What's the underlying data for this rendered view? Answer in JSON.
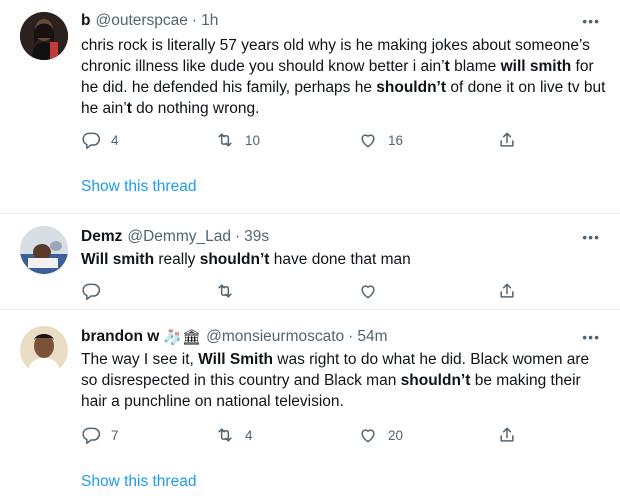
{
  "tweets": [
    {
      "name": "b",
      "handle": "@outerspcae",
      "time": "1h",
      "more": "•••",
      "text_parts": [
        {
          "t": "chris rock is literally 57 years old why is he making jokes about someone’s chronic illness like dude you should know better i ain’"
        },
        {
          "t": "t",
          "b": true
        },
        {
          "t": " blame "
        },
        {
          "t": "will smith",
          "b": true
        },
        {
          "t": " for he did. he defended his family, perhaps he "
        },
        {
          "t": "shouldn’t",
          "b": true
        },
        {
          "t": " of done it on live tv but he ain’"
        },
        {
          "t": "t",
          "b": true
        },
        {
          "t": " do nothing wrong."
        }
      ],
      "replies": "4",
      "retweets": "10",
      "likes": "16",
      "show_thread": "Show this thread"
    },
    {
      "name": "Demz",
      "handle": "@Demmy_Lad",
      "time": "39s",
      "more": "•••",
      "text_parts": [
        {
          "t": "Will smith",
          "b": true
        },
        {
          "t": " really "
        },
        {
          "t": "shouldn’t",
          "b": true
        },
        {
          "t": " have done that man"
        }
      ],
      "replies": "",
      "retweets": "",
      "likes": ""
    },
    {
      "name": "brandon w",
      "name_emojis": "🧦🏛",
      "handle": "@monsieurmoscato",
      "time": "54m",
      "more": "•••",
      "text_parts": [
        {
          "t": "The way I see it, "
        },
        {
          "t": "Will Smith",
          "b": true
        },
        {
          "t": " was right to do what he did. Black women are so disrespected in this country and Black man "
        },
        {
          "t": "shouldn’t",
          "b": true
        },
        {
          "t": " be making their hair a punchline on national television."
        }
      ],
      "replies": "7",
      "retweets": "4",
      "likes": "20",
      "show_thread": "Show this thread"
    }
  ],
  "icons": {
    "reply": "reply-icon",
    "retweet": "retweet-icon",
    "like": "like-icon",
    "share": "share-icon"
  },
  "colors": {
    "link": "#1d9bf0",
    "secondary": "#536471",
    "divider": "#e6ecf0"
  }
}
